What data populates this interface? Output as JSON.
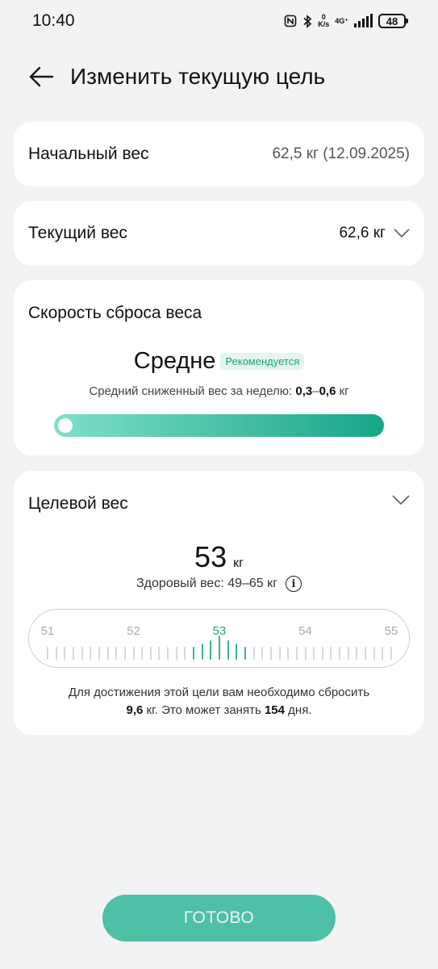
{
  "status_bar": {
    "time": "10:40",
    "speed_value": "0",
    "speed_unit": "K/s",
    "network": "4G⁺",
    "battery": "48",
    "icons": [
      "nfc-icon",
      "bluetooth-icon",
      "signal-icon",
      "battery-icon"
    ]
  },
  "header": {
    "title": "Изменить текущую цель"
  },
  "start_weight": {
    "label": "Начальный вес",
    "value": "62,5 кг (12.09.2025)"
  },
  "current_weight": {
    "label": "Текущий вес",
    "value": "62,6 кг"
  },
  "loss_speed": {
    "title": "Скорость сброса веса",
    "level": "Средне",
    "badge": "Рекомендуется",
    "desc_prefix": "Средний сниженный вес за неделю: ",
    "desc_min": "0,3",
    "desc_sep": "–",
    "desc_max": "0,6",
    "desc_unit": " кг",
    "slider_position": 0.0
  },
  "target_weight": {
    "title": "Целевой вес",
    "value": "53",
    "unit": "кг",
    "healthy_label": "Здоровый вес: 49–65 кг",
    "info_icon": "i",
    "ruler_labels": [
      "51",
      "52",
      "53",
      "54",
      "55"
    ],
    "ruler_selected": 53,
    "note_line1": "Для достижения этой цели вам необходимо сбросить",
    "note_amount": "9,6",
    "note_mid": " кг. Это может занять ",
    "note_days": "154",
    "note_end": " дня."
  },
  "done_button": {
    "label": "ГОТОВО"
  },
  "colors": {
    "accent": "#4dc0a6",
    "accent_dark": "#16a688",
    "badge_bg": "#e3f5ef",
    "badge_text": "#1aa37f",
    "background": "#f1f3f5"
  }
}
